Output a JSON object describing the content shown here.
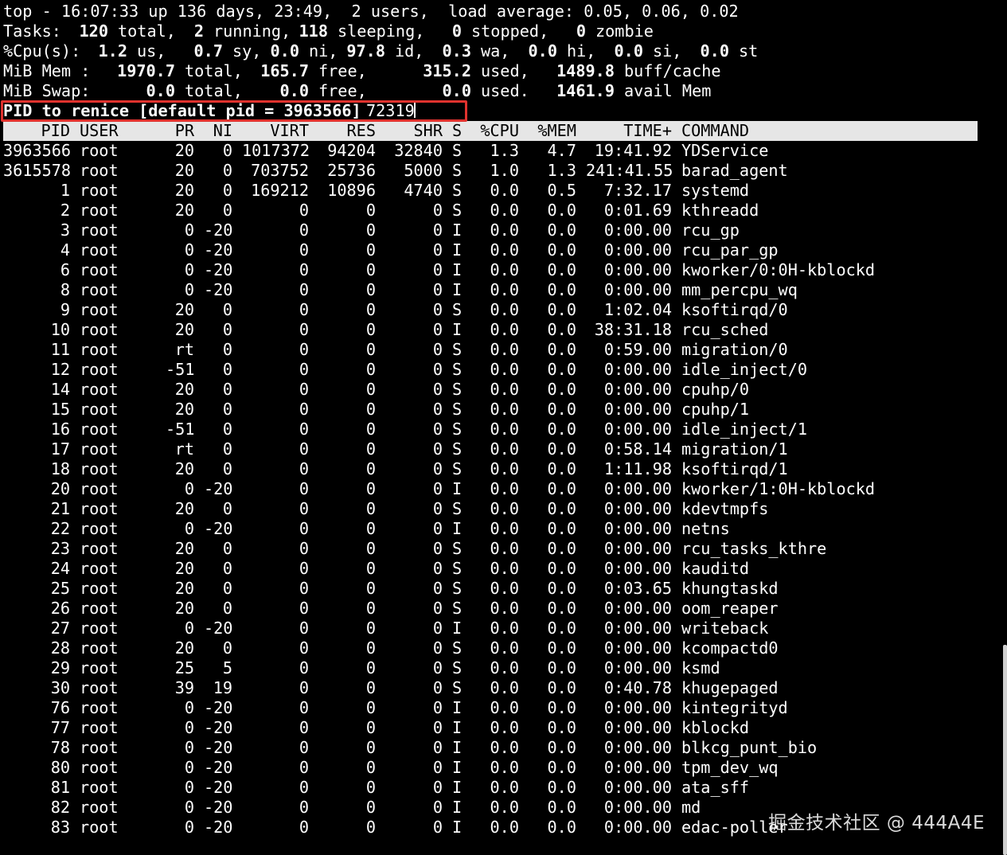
{
  "summary": {
    "line1": "top - 16:07:33 up 136 days, 23:49,  2 users,  load average: 0.05, 0.06, 0.02",
    "tasks": {
      "label": "Tasks:",
      "total": "120",
      "total_label": "total,",
      "running": "2",
      "running_label": "running,",
      "sleeping": "118",
      "sleeping_label": "sleeping,",
      "stopped": "0",
      "stopped_label": "stopped,",
      "zombie": "0",
      "zombie_label": "zombie"
    },
    "cpu": {
      "label": "%Cpu(s):",
      "us": "1.2",
      "us_label": "us,",
      "sy": "0.7",
      "sy_label": "sy,",
      "ni": "0.0",
      "ni_label": "ni,",
      "id": "97.8",
      "id_label": "id,",
      "wa": "0.3",
      "wa_label": "wa,",
      "hi": "0.0",
      "hi_label": "hi,",
      "si": "0.0",
      "si_label": "si,",
      "st": "0.0",
      "st_label": "st"
    },
    "mem": {
      "label": "MiB Mem :",
      "total": "1970.7",
      "total_label": "total,",
      "free": "165.7",
      "free_label": "free,",
      "used": "315.2",
      "used_label": "used,",
      "buff": "1489.8",
      "buff_label": "buff/cache"
    },
    "swap": {
      "label": "MiB Swap:",
      "total": "0.0",
      "total_label": "total,",
      "free": "0.0",
      "free_label": "free,",
      "used": "0.0",
      "used_label": "used.",
      "avail": "1461.9",
      "avail_label": "avail Mem"
    }
  },
  "prompt": {
    "text": "PID to renice [default pid = 3963566]",
    "input_value": "72319"
  },
  "columns": [
    "PID",
    "USER",
    "PR",
    "NI",
    "VIRT",
    "RES",
    "SHR",
    "S",
    "%CPU",
    "%MEM",
    "TIME+",
    "COMMAND"
  ],
  "processes": [
    [
      "3963566",
      "root",
      "20",
      "0",
      "1017372",
      "94204",
      "32840",
      "S",
      "1.3",
      "4.7",
      "19:41.92",
      "YDService"
    ],
    [
      "3615578",
      "root",
      "20",
      "0",
      "703752",
      "25736",
      "5000",
      "S",
      "1.0",
      "1.3",
      "241:41.55",
      "barad_agent"
    ],
    [
      "1",
      "root",
      "20",
      "0",
      "169212",
      "10896",
      "4740",
      "S",
      "0.0",
      "0.5",
      "7:32.17",
      "systemd"
    ],
    [
      "2",
      "root",
      "20",
      "0",
      "0",
      "0",
      "0",
      "S",
      "0.0",
      "0.0",
      "0:01.69",
      "kthreadd"
    ],
    [
      "3",
      "root",
      "0",
      "-20",
      "0",
      "0",
      "0",
      "I",
      "0.0",
      "0.0",
      "0:00.00",
      "rcu_gp"
    ],
    [
      "4",
      "root",
      "0",
      "-20",
      "0",
      "0",
      "0",
      "I",
      "0.0",
      "0.0",
      "0:00.00",
      "rcu_par_gp"
    ],
    [
      "6",
      "root",
      "0",
      "-20",
      "0",
      "0",
      "0",
      "I",
      "0.0",
      "0.0",
      "0:00.00",
      "kworker/0:0H-kblockd"
    ],
    [
      "8",
      "root",
      "0",
      "-20",
      "0",
      "0",
      "0",
      "I",
      "0.0",
      "0.0",
      "0:00.00",
      "mm_percpu_wq"
    ],
    [
      "9",
      "root",
      "20",
      "0",
      "0",
      "0",
      "0",
      "S",
      "0.0",
      "0.0",
      "1:02.04",
      "ksoftirqd/0"
    ],
    [
      "10",
      "root",
      "20",
      "0",
      "0",
      "0",
      "0",
      "I",
      "0.0",
      "0.0",
      "38:31.18",
      "rcu_sched"
    ],
    [
      "11",
      "root",
      "rt",
      "0",
      "0",
      "0",
      "0",
      "S",
      "0.0",
      "0.0",
      "0:59.00",
      "migration/0"
    ],
    [
      "12",
      "root",
      "-51",
      "0",
      "0",
      "0",
      "0",
      "S",
      "0.0",
      "0.0",
      "0:00.00",
      "idle_inject/0"
    ],
    [
      "14",
      "root",
      "20",
      "0",
      "0",
      "0",
      "0",
      "S",
      "0.0",
      "0.0",
      "0:00.00",
      "cpuhp/0"
    ],
    [
      "15",
      "root",
      "20",
      "0",
      "0",
      "0",
      "0",
      "S",
      "0.0",
      "0.0",
      "0:00.00",
      "cpuhp/1"
    ],
    [
      "16",
      "root",
      "-51",
      "0",
      "0",
      "0",
      "0",
      "S",
      "0.0",
      "0.0",
      "0:00.00",
      "idle_inject/1"
    ],
    [
      "17",
      "root",
      "rt",
      "0",
      "0",
      "0",
      "0",
      "S",
      "0.0",
      "0.0",
      "0:58.14",
      "migration/1"
    ],
    [
      "18",
      "root",
      "20",
      "0",
      "0",
      "0",
      "0",
      "S",
      "0.0",
      "0.0",
      "1:11.98",
      "ksoftirqd/1"
    ],
    [
      "20",
      "root",
      "0",
      "-20",
      "0",
      "0",
      "0",
      "I",
      "0.0",
      "0.0",
      "0:00.00",
      "kworker/1:0H-kblockd"
    ],
    [
      "21",
      "root",
      "20",
      "0",
      "0",
      "0",
      "0",
      "S",
      "0.0",
      "0.0",
      "0:00.00",
      "kdevtmpfs"
    ],
    [
      "22",
      "root",
      "0",
      "-20",
      "0",
      "0",
      "0",
      "I",
      "0.0",
      "0.0",
      "0:00.00",
      "netns"
    ],
    [
      "23",
      "root",
      "20",
      "0",
      "0",
      "0",
      "0",
      "S",
      "0.0",
      "0.0",
      "0:00.00",
      "rcu_tasks_kthre"
    ],
    [
      "24",
      "root",
      "20",
      "0",
      "0",
      "0",
      "0",
      "S",
      "0.0",
      "0.0",
      "0:00.00",
      "kauditd"
    ],
    [
      "25",
      "root",
      "20",
      "0",
      "0",
      "0",
      "0",
      "S",
      "0.0",
      "0.0",
      "0:03.65",
      "khungtaskd"
    ],
    [
      "26",
      "root",
      "20",
      "0",
      "0",
      "0",
      "0",
      "S",
      "0.0",
      "0.0",
      "0:00.00",
      "oom_reaper"
    ],
    [
      "27",
      "root",
      "0",
      "-20",
      "0",
      "0",
      "0",
      "I",
      "0.0",
      "0.0",
      "0:00.00",
      "writeback"
    ],
    [
      "28",
      "root",
      "20",
      "0",
      "0",
      "0",
      "0",
      "S",
      "0.0",
      "0.0",
      "0:00.00",
      "kcompactd0"
    ],
    [
      "29",
      "root",
      "25",
      "5",
      "0",
      "0",
      "0",
      "S",
      "0.0",
      "0.0",
      "0:00.00",
      "ksmd"
    ],
    [
      "30",
      "root",
      "39",
      "19",
      "0",
      "0",
      "0",
      "S",
      "0.0",
      "0.0",
      "0:40.78",
      "khugepaged"
    ],
    [
      "76",
      "root",
      "0",
      "-20",
      "0",
      "0",
      "0",
      "I",
      "0.0",
      "0.0",
      "0:00.00",
      "kintegrityd"
    ],
    [
      "77",
      "root",
      "0",
      "-20",
      "0",
      "0",
      "0",
      "I",
      "0.0",
      "0.0",
      "0:00.00",
      "kblockd"
    ],
    [
      "78",
      "root",
      "0",
      "-20",
      "0",
      "0",
      "0",
      "I",
      "0.0",
      "0.0",
      "0:00.00",
      "blkcg_punt_bio"
    ],
    [
      "80",
      "root",
      "0",
      "-20",
      "0",
      "0",
      "0",
      "I",
      "0.0",
      "0.0",
      "0:00.00",
      "tpm_dev_wq"
    ],
    [
      "81",
      "root",
      "0",
      "-20",
      "0",
      "0",
      "0",
      "I",
      "0.0",
      "0.0",
      "0:00.00",
      "ata_sff"
    ],
    [
      "82",
      "root",
      "0",
      "-20",
      "0",
      "0",
      "0",
      "I",
      "0.0",
      "0.0",
      "0:00.00",
      "md"
    ],
    [
      "83",
      "root",
      "0",
      "-20",
      "0",
      "0",
      "0",
      "I",
      "0.0",
      "0.0",
      "0:00.00",
      "edac-poller"
    ]
  ],
  "watermark": "掘金技术社区 @ 444A4E",
  "colors": {
    "background": "#000000",
    "foreground": "#ffffff",
    "header_bar": "#e6e6e6",
    "highlight_box": "#e0322e"
  }
}
